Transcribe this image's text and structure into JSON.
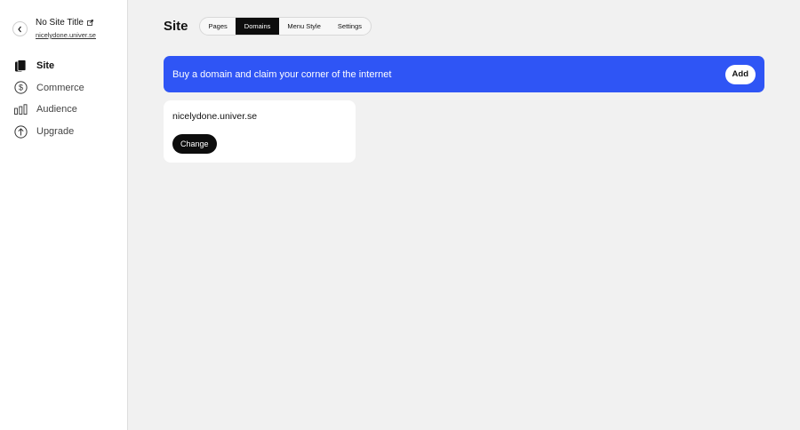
{
  "sidebar": {
    "back_icon": "chevron-left-icon",
    "site_title": "No Site Title",
    "edit_icon": "external-edit-icon",
    "site_url": "nicelydone.univer.se",
    "items": [
      {
        "label": "Site",
        "icon": "pages-icon",
        "active": true
      },
      {
        "label": "Commerce",
        "icon": "dollar-icon",
        "active": false
      },
      {
        "label": "Audience",
        "icon": "bars-icon",
        "active": false
      },
      {
        "label": "Upgrade",
        "icon": "arrow-up-circle-icon",
        "active": false
      }
    ]
  },
  "main": {
    "title": "Site",
    "tabs": [
      {
        "label": "Pages",
        "active": false
      },
      {
        "label": "Domains",
        "active": true
      },
      {
        "label": "Menu Style",
        "active": false
      },
      {
        "label": "Settings",
        "active": false
      }
    ],
    "banner": {
      "text": "Buy a domain and claim your corner of the internet",
      "button_label": "Add",
      "color": "#2f55f5"
    },
    "domain_card": {
      "domain": "nicelydone.univer.se",
      "button_label": "Change"
    }
  }
}
